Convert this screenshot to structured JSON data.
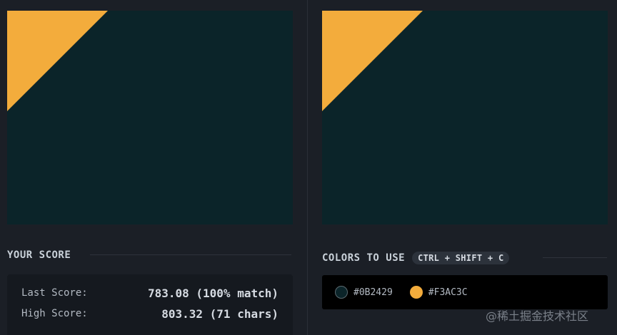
{
  "colors": {
    "background": "#0B2429",
    "shape": "#F3AC3C"
  },
  "score": {
    "title": "YOUR SCORE",
    "last_label": "Last Score:",
    "last_value": "783.08 (100% match)",
    "high_label": "High Score:",
    "high_value": "803.32 (71 chars)"
  },
  "palette": {
    "title": "COLORS TO USE",
    "shortcut": "CTRL + SHIFT + C",
    "items": [
      {
        "code": "#0B2429",
        "color": "#0B2429"
      },
      {
        "code": "#F3AC3C",
        "color": "#F3AC3C"
      }
    ]
  },
  "watermark": "@稀土掘金技术社区"
}
